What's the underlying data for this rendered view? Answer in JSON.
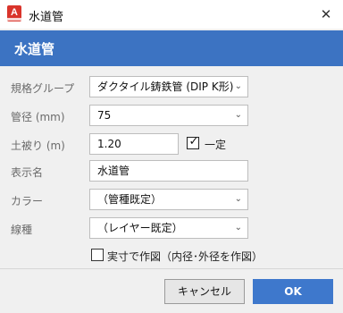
{
  "window": {
    "title": "水道管",
    "close_glyph": "✕",
    "app_icon": "A"
  },
  "header": {
    "title": "水道管"
  },
  "fields": {
    "spec_group": {
      "label": "規格グループ",
      "value": "ダクタイル鋳鉄管 (DIP K形)"
    },
    "diameter": {
      "label": "管径 (mm)",
      "value": "75"
    },
    "cover_depth": {
      "label": "土被り (m)",
      "value": "1.20",
      "fixed_label": "一定",
      "fixed_checked": true
    },
    "display_name": {
      "label": "表示名",
      "value": "水道管"
    },
    "color": {
      "label": "カラー",
      "value": "（管種既定）"
    },
    "line_type": {
      "label": "線種",
      "value": "（レイヤー既定）"
    },
    "actual_size": {
      "label": "実寸で作図（内径･外径を作図）",
      "checked": false
    }
  },
  "buttons": {
    "cancel": "キャンセル",
    "ok": "OK"
  },
  "colors": {
    "accent": "#3c73c2",
    "ok_button": "#3e78cc"
  },
  "icons": {
    "chevron": "chevron-down-icon",
    "check": "checkmark-icon"
  }
}
